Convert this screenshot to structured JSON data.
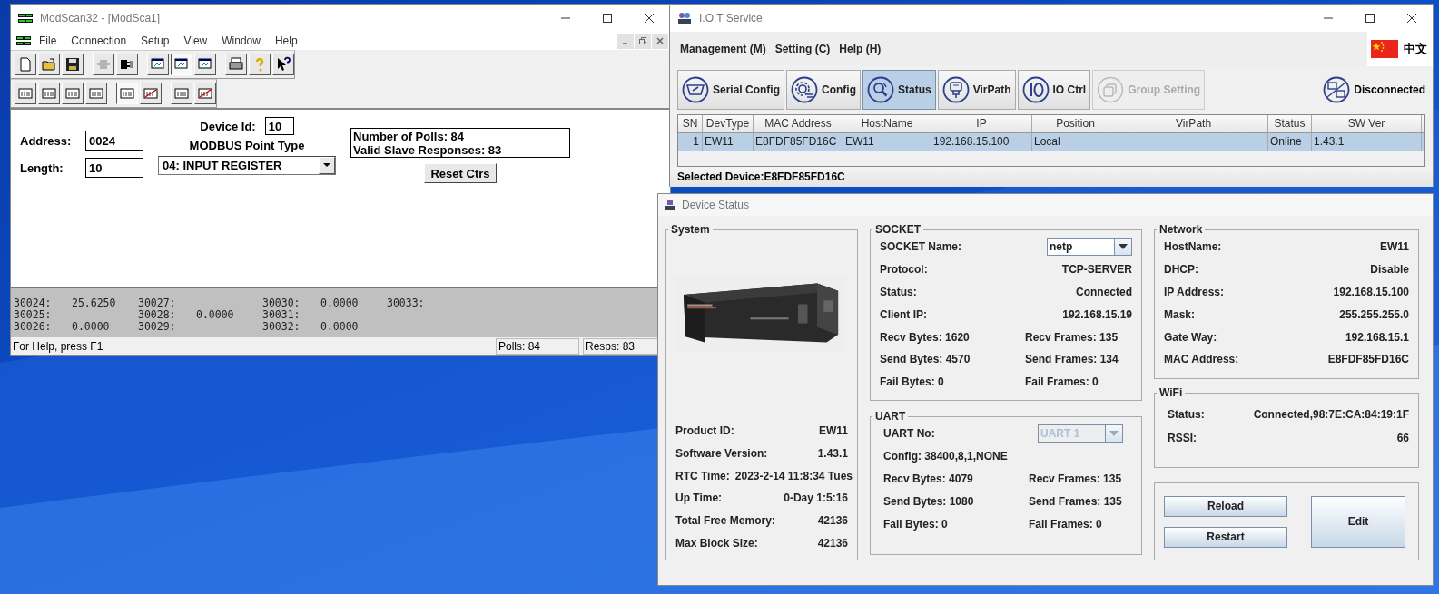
{
  "modscan": {
    "title": "ModScan32 - [ModSca1]",
    "menu": [
      "File",
      "Connection",
      "Setup",
      "View",
      "Window",
      "Help"
    ],
    "toolbar": [
      {
        "kind": "new",
        "selected": false,
        "disabled": false
      },
      {
        "kind": "open",
        "selected": false,
        "disabled": false
      },
      {
        "kind": "save",
        "selected": false,
        "disabled": false
      },
      {
        "kind": "connect",
        "selected": false,
        "disabled": true
      },
      {
        "kind": "disconnect",
        "selected": false,
        "disabled": false
      },
      {
        "kind": "display",
        "selected": false,
        "disabled": false
      },
      {
        "kind": "display",
        "selected": true,
        "disabled": false
      },
      {
        "kind": "display",
        "selected": false,
        "disabled": false
      },
      {
        "kind": "print",
        "selected": false,
        "disabled": false
      },
      {
        "kind": "help",
        "selected": false,
        "disabled": false
      },
      {
        "kind": "context-help",
        "selected": false,
        "disabled": false
      }
    ],
    "format_toolbar": [
      {
        "kind": "format",
        "selected": false
      },
      {
        "kind": "format",
        "selected": false
      },
      {
        "kind": "format",
        "selected": false
      },
      {
        "kind": "format",
        "selected": false
      },
      {
        "kind": "format",
        "selected": true
      },
      {
        "kind": "format-swapped",
        "selected": false
      },
      {
        "kind": "format",
        "selected": false
      },
      {
        "kind": "format-swapped",
        "selected": false
      }
    ],
    "form": {
      "address_label": "Address:",
      "address": "0024",
      "length_label": "Length:",
      "length": "10",
      "device_id_label": "Device Id:",
      "device_id": "10",
      "point_type_label": "MODBUS Point Type",
      "point_type": "04: INPUT REGISTER",
      "polls": "Number of Polls: 84",
      "responses": "Valid Slave Responses: 83",
      "reset_button": "Reset Ctrs"
    },
    "register_columns": [
      [
        {
          "address": "30024:",
          "value": "25.6250"
        },
        {
          "address": "30025:"
        },
        {
          "address": "30026:",
          "value": "0.0000"
        }
      ],
      [
        {
          "address": "30027:"
        },
        {
          "address": "30028:",
          "value": "0.0000"
        },
        {
          "address": "30029:"
        }
      ],
      [
        {
          "address": "30030:",
          "value": "0.0000"
        },
        {
          "address": "30031:"
        },
        {
          "address": "30032:",
          "value": "0.0000"
        }
      ],
      [
        {
          "address": "30033:"
        }
      ]
    ],
    "status_bar": {
      "help": "For Help, press F1",
      "polls": "Polls: 84",
      "resps": "Resps: 83"
    }
  },
  "iot_service": {
    "title": "I.O.T Service",
    "menu": [
      "Management (M)",
      "Setting (C)",
      "Help (H)"
    ],
    "language": "中文",
    "toolbar": [
      {
        "label": "Serial Config",
        "kind": "serial",
        "selected": false,
        "disabled": false
      },
      {
        "label": "Config",
        "kind": "config",
        "selected": false,
        "disabled": false
      },
      {
        "label": "Status",
        "kind": "status",
        "selected": true,
        "disabled": false
      },
      {
        "label": "VirPath",
        "kind": "virpath",
        "selected": false,
        "disabled": false
      },
      {
        "label": "IO Ctrl",
        "kind": "io",
        "selected": false,
        "disabled": false
      },
      {
        "label": "Group Setting",
        "kind": "group",
        "selected": false,
        "disabled": true
      }
    ],
    "connection": "Disconnected",
    "table": {
      "columns": [
        "SN",
        "DevType",
        "MAC Address",
        "HostName",
        "IP",
        "Position",
        "VirPath",
        "Status",
        "SW Ver"
      ],
      "rows": [
        {
          "cells": [
            "1",
            "EW11",
            "E8FDF85FD16C",
            "EW11",
            "192.168.15.100",
            "Local",
            null,
            "Online",
            "1.43.1"
          ],
          "selected": true
        }
      ]
    },
    "selected_device": "Selected Device:E8FDF85FD16C"
  },
  "device_status": {
    "title": "Device Status",
    "system": {
      "title": "System",
      "rows": [
        {
          "label": "Product ID:",
          "value": "EW11"
        },
        {
          "label": "Software Version:",
          "value": "1.43.1"
        },
        {
          "label": "RTC Time:",
          "value": "2023-2-14 11:8:34 Tues"
        },
        {
          "label": "Up Time:",
          "value": "0-Day 1:5:16"
        },
        {
          "label": "Total Free Memory:",
          "value": "42136"
        },
        {
          "label": "Max Block Size:",
          "value": "42136"
        }
      ]
    },
    "socket": {
      "title": "SOCKET",
      "name_label": "SOCKET Name:",
      "name": "netp",
      "rows": [
        {
          "label": "Protocol:",
          "value": "TCP-SERVER"
        },
        {
          "label": "Status:",
          "value": "Connected"
        },
        {
          "label": "Client IP:",
          "value": "192.168.15.19"
        }
      ],
      "counters": [
        [
          "Recv Bytes: 1620",
          "Recv Frames: 135"
        ],
        [
          "Send Bytes: 4570",
          "Send Frames: 134"
        ],
        [
          "Fail Bytes: 0",
          "Fail Frames: 0"
        ]
      ]
    },
    "uart": {
      "title": "UART",
      "no_label": "UART No:",
      "no": "UART 1",
      "no_disabled": true,
      "config": "Config: 38400,8,1,NONE",
      "counters": [
        [
          "Recv Bytes: 4079",
          "Recv Frames: 135"
        ],
        [
          "Send Bytes: 1080",
          "Send Frames: 135"
        ],
        [
          "Fail Bytes: 0",
          "Fail Frames: 0"
        ]
      ]
    },
    "network": {
      "title": "Network",
      "rows": [
        {
          "label": "HostName:",
          "value": "EW11"
        },
        {
          "label": "DHCP:",
          "value": "Disable"
        },
        {
          "label": "IP Address:",
          "value": "192.168.15.100"
        },
        {
          "label": "Mask:",
          "value": "255.255.255.0"
        },
        {
          "label": "Gate Way:",
          "value": "192.168.15.1"
        },
        {
          "label": "MAC Address:",
          "value": "E8FDF85FD16C"
        }
      ]
    },
    "wifi": {
      "title": "WiFi",
      "rows": [
        {
          "label": "Status:",
          "value": "Connected,98:7E:CA:84:19:1F"
        },
        {
          "label": "RSSI:",
          "value": "66"
        }
      ]
    },
    "buttons": {
      "reload": "Reload",
      "restart": "Restart",
      "edit": "Edit"
    }
  }
}
